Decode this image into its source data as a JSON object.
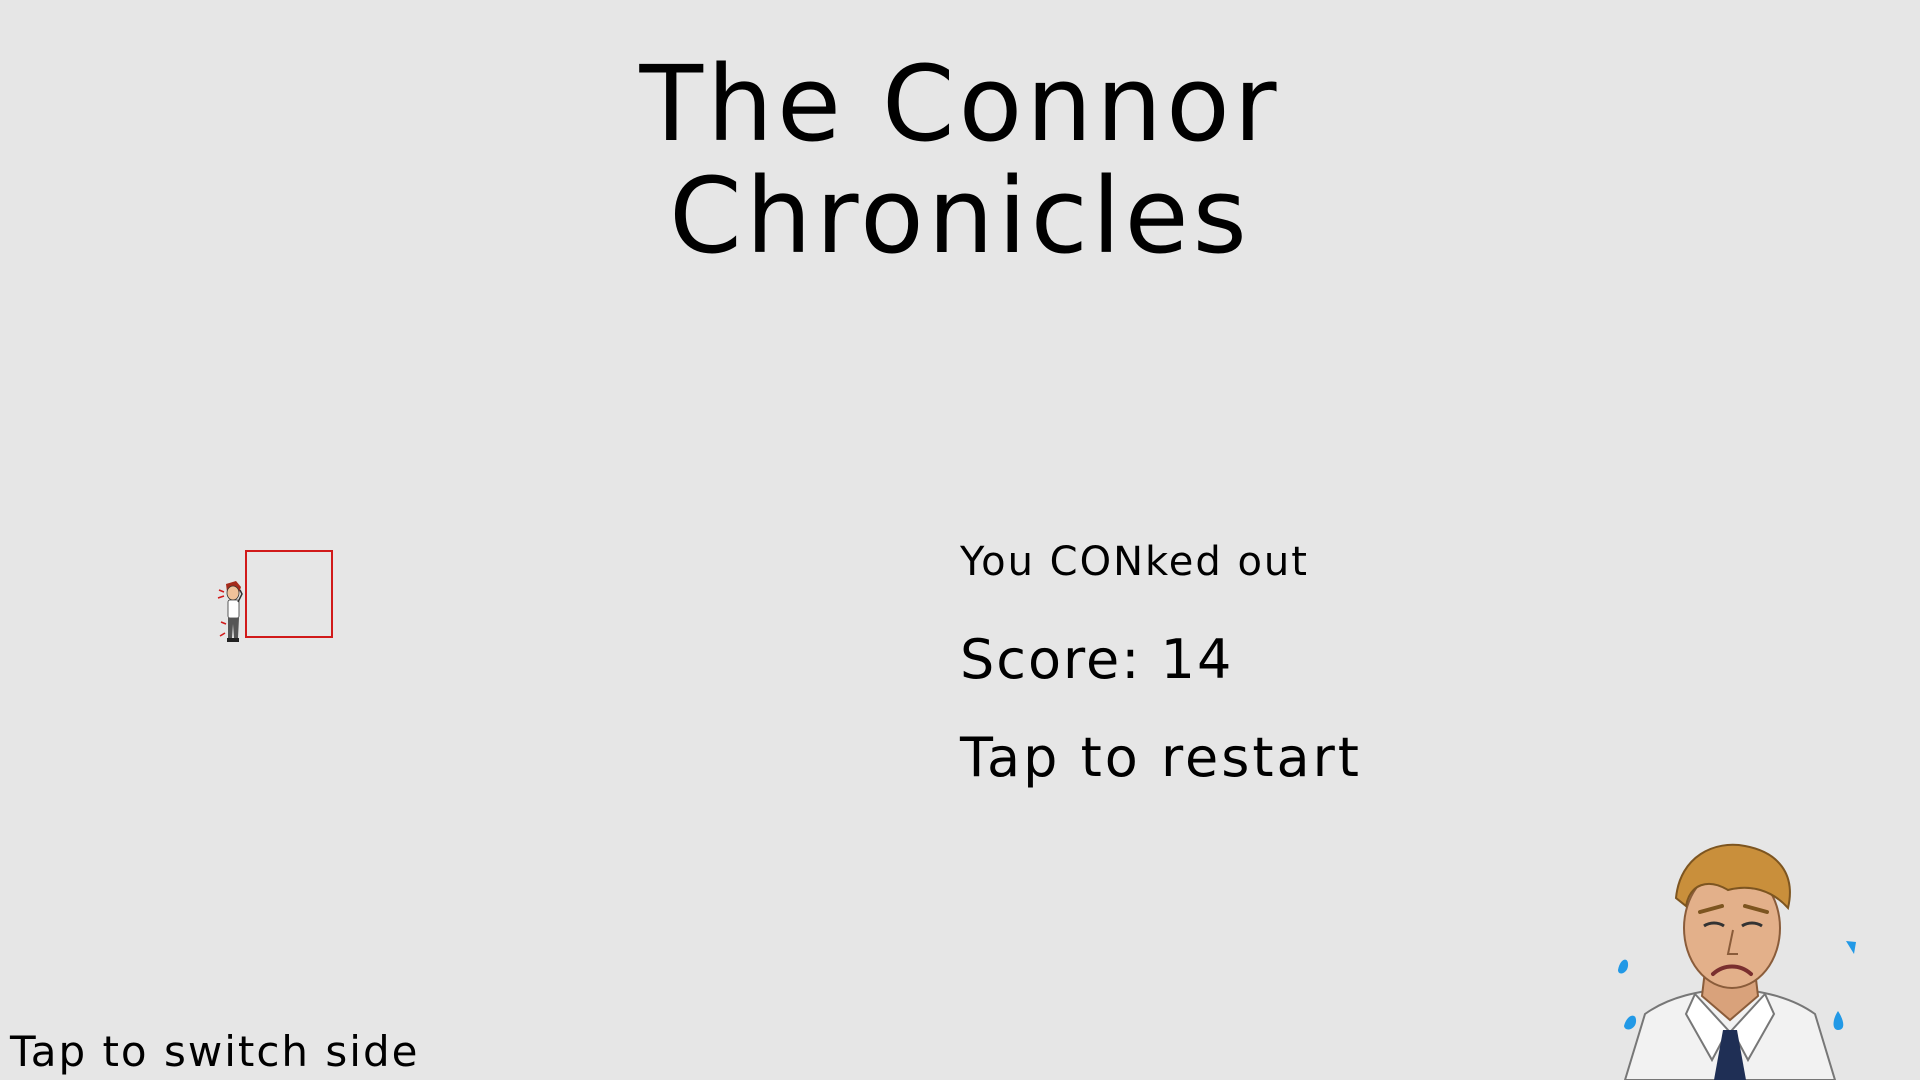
{
  "game": {
    "title_line1": "The Connor",
    "title_line2": "Chronicles"
  },
  "game_over": {
    "message": "You CONked out",
    "score_label": "Score:",
    "score_value": 14,
    "restart_prompt": "Tap to restart"
  },
  "hint": {
    "switch_side": "Tap to switch side"
  },
  "colors": {
    "background": "#e6e6e6",
    "obstacle_outline": "#d11a1a",
    "text": "#000000"
  },
  "icons": {
    "player": "player-sprite",
    "sad_character": "sweating-sad-character",
    "obstacle": "empty-red-square"
  }
}
